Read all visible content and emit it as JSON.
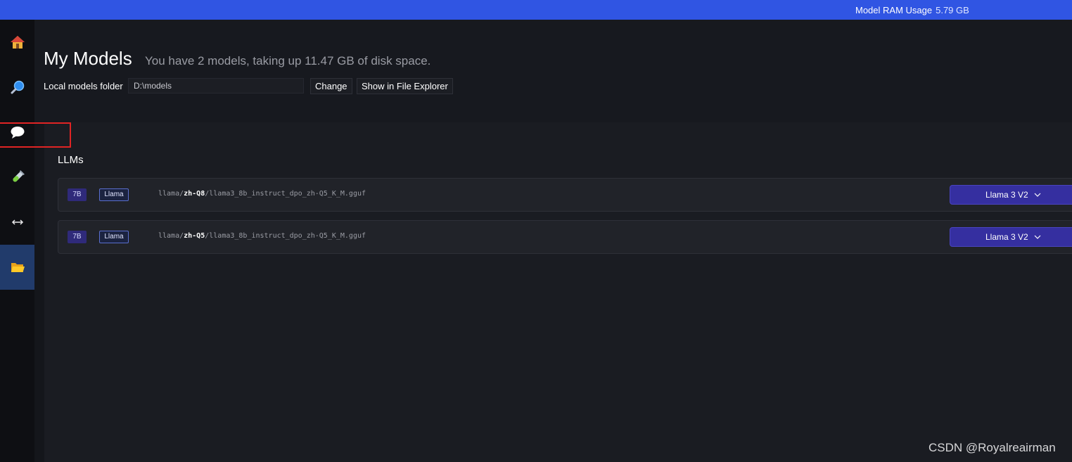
{
  "topbar": {
    "ram_label": "Model RAM Usage",
    "ram_value": "5.79 GB"
  },
  "sidebar": {
    "items": [
      {
        "icon": "home-icon"
      },
      {
        "icon": "search-icon"
      },
      {
        "icon": "chat-icon"
      },
      {
        "icon": "test-tube-icon"
      },
      {
        "icon": "arrows-icon"
      },
      {
        "icon": "folder-icon",
        "active": true
      }
    ]
  },
  "header": {
    "title": "My Models",
    "subtitle": "You have 2 models, taking up 11.47 GB of disk space.",
    "folder_label": "Local models folder",
    "folder_value": "D:\\models",
    "change_label": "Change",
    "explorer_label": "Show in File Explorer"
  },
  "section": {
    "title": "LLMs"
  },
  "models": [
    {
      "size": "7B",
      "arch": "Llama",
      "path_prefix": "llama/",
      "path_highlight": "zh-Q8",
      "path_suffix": "/llama3_8b_instruct_dpo_zh-Q5_K_M.gguf",
      "preset": "Llama 3 V2"
    },
    {
      "size": "7B",
      "arch": "Llama",
      "path_prefix": "llama/",
      "path_highlight": "zh-Q5",
      "path_suffix": "/llama3_8b_instruct_dpo_zh-Q5_K_M.gguf",
      "preset": "Llama 3 V2"
    }
  ],
  "watermark": "CSDN @Royalreairman",
  "colors": {
    "topbar": "#3055e3",
    "sidebar_active": "#213b6b",
    "preset_button": "#352fa0",
    "annotation": "#e02424"
  }
}
